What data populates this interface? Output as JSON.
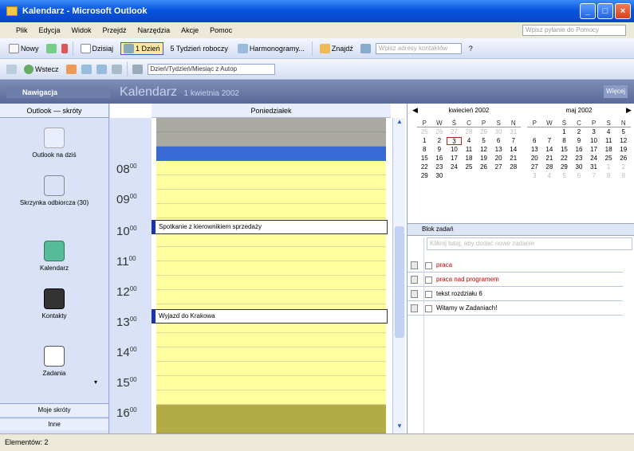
{
  "window": {
    "title": "Kalendarz - Microsoft Outlook",
    "minimize": "_",
    "maximize": "□",
    "close": "×"
  },
  "menu": {
    "items": [
      "Plik",
      "Edycja",
      "Widok",
      "Przejdź",
      "Narzędzia",
      "Akcje",
      "Pomoc"
    ],
    "help_placeholder": "Wpisz pytanie do Pomocy"
  },
  "toolbar1": {
    "new_label": "Nowy",
    "today_label": "Dzisiaj",
    "day_label": "1 Dzień",
    "workweek_label": "5 Tydzień roboczy",
    "month_label": "Harmonogramy...",
    "find_label": "Znajdź",
    "search_placeholder": "Wpisz adresy kontaktów",
    "help_icon": "?"
  },
  "toolbar2": {
    "back_label": "Wstecz",
    "view_combo": "Dzień/Tydzień/Miesiąc z Autop"
  },
  "panebar": {
    "nav_title": "Nawigacja",
    "cal_title": "Kalendarz",
    "cal_date": "1 kwietnia 2002",
    "right_btn": "Więcej"
  },
  "nav": {
    "header": "Outlook — skróty",
    "items": [
      {
        "label": "Outlook na dziś"
      },
      {
        "label": "Skrzynka odbiorcza (30)"
      },
      {
        "label": "Kalendarz"
      },
      {
        "label": "Kontakty"
      },
      {
        "label": "Zadania"
      }
    ],
    "my_shortcuts": "Moje skróty",
    "other": "Inne"
  },
  "calendar": {
    "day_header": "Poniedziałek",
    "hours": [
      {
        "h": "08",
        "m": "00"
      },
      {
        "h": "09",
        "m": "00"
      },
      {
        "h": "10",
        "m": "00"
      },
      {
        "h": "11",
        "m": "00"
      },
      {
        "h": "12",
        "m": "00"
      },
      {
        "h": "13",
        "m": "00"
      },
      {
        "h": "14",
        "m": "00"
      },
      {
        "h": "15",
        "m": "00"
      },
      {
        "h": "16",
        "m": "00"
      }
    ],
    "appointments": [
      {
        "time": "10:00",
        "title": "Spotkanie z kierownikiem sprzedaży"
      },
      {
        "time": "13:00",
        "title": "Wyjazd do Krakowa"
      }
    ]
  },
  "minical": {
    "left": {
      "title": "kwiecień 2002",
      "days_header": [
        "P",
        "W",
        "Ś",
        "C",
        "P",
        "S",
        "N"
      ],
      "weeks": [
        [
          "25",
          "26",
          "27",
          "28",
          "29",
          "30",
          "31"
        ],
        [
          "1",
          "2",
          "3",
          "4",
          "5",
          "6",
          "7"
        ],
        [
          "8",
          "9",
          "10",
          "11",
          "12",
          "13",
          "14"
        ],
        [
          "15",
          "16",
          "17",
          "18",
          "19",
          "20",
          "21"
        ],
        [
          "22",
          "23",
          "24",
          "25",
          "26",
          "27",
          "28"
        ],
        [
          "29",
          "30",
          "",
          "",
          "",
          "",
          ""
        ]
      ]
    },
    "right": {
      "title": "maj 2002",
      "days_header": [
        "P",
        "W",
        "Ś",
        "C",
        "P",
        "S",
        "N"
      ],
      "weeks": [
        [
          "",
          "",
          "1",
          "2",
          "3",
          "4",
          "5"
        ],
        [
          "6",
          "7",
          "8",
          "9",
          "10",
          "11",
          "12"
        ],
        [
          "13",
          "14",
          "15",
          "16",
          "17",
          "18",
          "19"
        ],
        [
          "20",
          "21",
          "22",
          "23",
          "24",
          "25",
          "26"
        ],
        [
          "27",
          "28",
          "29",
          "30",
          "31",
          "1",
          "2"
        ],
        [
          "3",
          "4",
          "5",
          "6",
          "7",
          "8",
          "9"
        ]
      ]
    }
  },
  "tasks": {
    "header": "Blok zadań",
    "placeholder": "Kliknij tutaj, aby dodać nowe zadanie",
    "items": [
      {
        "label": "praca",
        "overdue": true
      },
      {
        "label": "praca nad programem",
        "overdue": true
      },
      {
        "label": "tekst rozdziału 6",
        "overdue": false
      },
      {
        "label": "Witamy w Zadaniach!",
        "overdue": false
      }
    ]
  },
  "status": {
    "text": "Elementów: 2"
  },
  "colors": {
    "work_hours": "#fffe9f",
    "selected_slot": "#3a6bd4",
    "appointment_bar": "#1c33b0",
    "overdue_task": "#cc0000"
  }
}
